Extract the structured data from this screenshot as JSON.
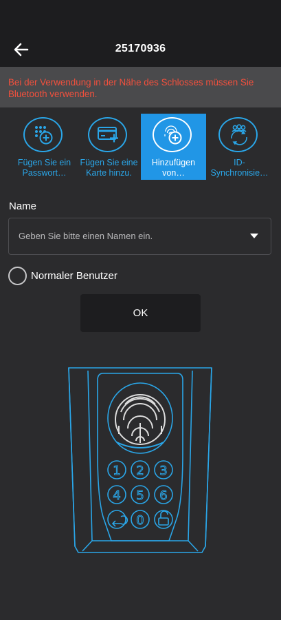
{
  "header": {
    "title": "25170936",
    "back_icon": "arrow-left-icon"
  },
  "banner": {
    "text": "Bei der Verwendung in der Nähe des Schlosses müssen Sie Bluetooth verwenden.",
    "color": "#f2503d"
  },
  "tabs": [
    {
      "label": "Fügen Sie ein Passwort…",
      "icon": "keypad-plus-icon",
      "active": false
    },
    {
      "label": "Fügen Sie eine Karte hinzu.",
      "icon": "card-plus-icon",
      "active": false
    },
    {
      "label": "Hinzufügen von…",
      "icon": "fingerprint-plus-icon",
      "active": true
    },
    {
      "label": "ID-Synchronisie…",
      "icon": "user-sync-icon",
      "active": false
    }
  ],
  "form": {
    "name_label": "Name",
    "name_placeholder": "Geben Sie bitte einen Namen ein.",
    "user_type_label": "Normaler Benutzer",
    "ok_label": "OK"
  },
  "lock_keypad": {
    "keys": [
      "1",
      "2",
      "3",
      "4",
      "5",
      "6",
      "0"
    ]
  },
  "colors": {
    "accent": "#2196e6",
    "outline": "#2aa6e8",
    "background": "#2b2b2d",
    "topbar": "#1d1d1f"
  }
}
